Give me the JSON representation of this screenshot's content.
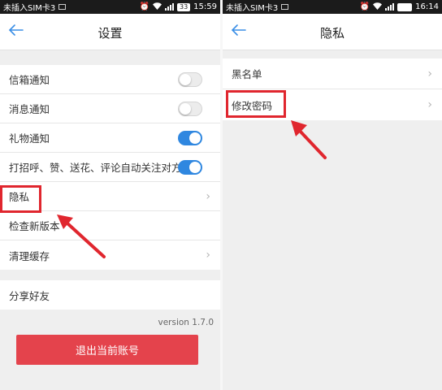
{
  "colors": {
    "accent": "#2f87e0",
    "danger": "#e4434c",
    "highlight": "#e0262e",
    "statusbar": "#1b1b1b"
  },
  "left": {
    "status": {
      "carrier": "未插入SIM卡3",
      "battery": "33",
      "time": "15:59"
    },
    "header": {
      "title": "设置",
      "back_icon": "arrow-left-icon"
    },
    "settings": [
      {
        "label": "信箱通知",
        "control": "toggle",
        "on": false
      },
      {
        "label": "消息通知",
        "control": "toggle",
        "on": false
      },
      {
        "label": "礼物通知",
        "control": "toggle",
        "on": true
      },
      {
        "label": "打招呼、赞、送花、评论自动关注对方",
        "control": "toggle",
        "on": true
      },
      {
        "label": "隐私",
        "control": "chevron"
      },
      {
        "label": "检查新版本",
        "control": "none"
      },
      {
        "label": "清理缓存",
        "control": "chevron"
      }
    ],
    "share": {
      "label": "分享好友"
    },
    "version": "version  1.7.0",
    "logout_label": "退出当前账号"
  },
  "right": {
    "status": {
      "carrier": "未插入SIM卡3",
      "battery": "",
      "time": "16:14"
    },
    "header": {
      "title": "隐私",
      "back_icon": "arrow-left-icon"
    },
    "items": [
      {
        "label": "黑名单"
      },
      {
        "label": "修改密码"
      }
    ]
  }
}
